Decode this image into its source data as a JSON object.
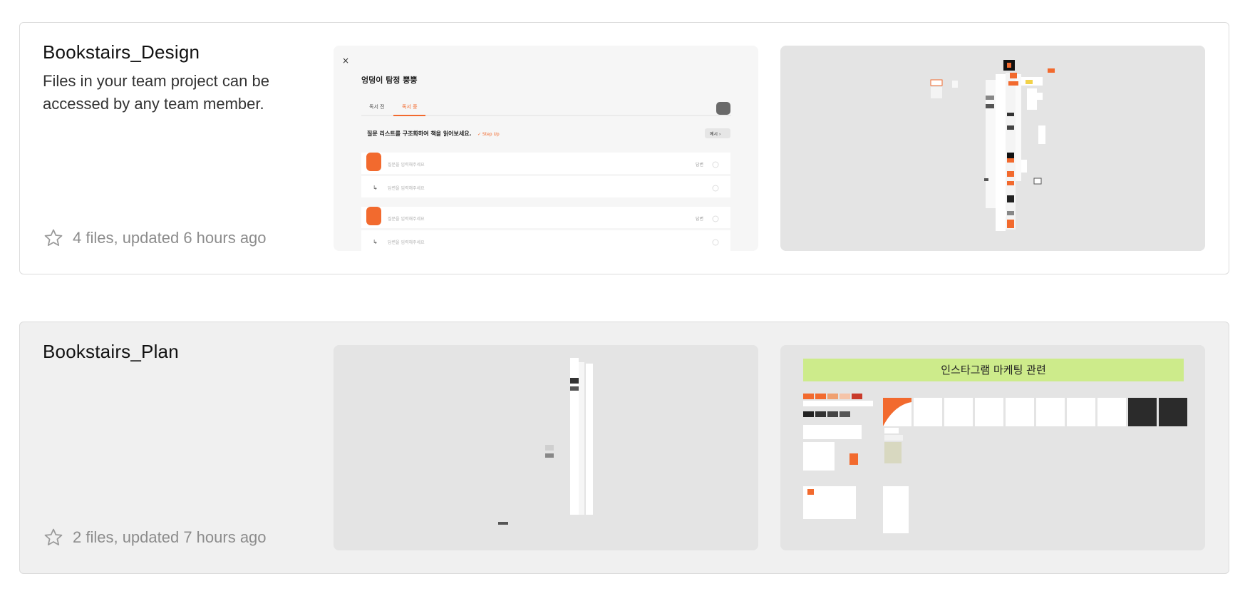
{
  "projects": [
    {
      "name": "Bookstairs_Design",
      "description": "Files in your team project can be accessed by any team member.",
      "meta": "4 files, updated 6 hours ago",
      "thumbnails": [
        {
          "close": "×",
          "title": "엉덩이 탐정 뿡뿡",
          "tabs": [
            "독서 전",
            "독서 중"
          ],
          "heading": "질문 리스트를 구조화하여 책을 읽어보세요.",
          "step": "✓ Step Up",
          "button": "예시 ›",
          "q_placeholder": "질문을 입력해주세요",
          "a_placeholder": "답변을 입력해주세요",
          "row_action": "답변"
        },
        {}
      ]
    },
    {
      "name": "Bookstairs_Plan",
      "description": "",
      "meta": "2 files, updated 7 hours ago",
      "thumbnails": [
        {},
        {
          "banner": "인스타그램 마케팅 관련"
        }
      ]
    }
  ],
  "colors": {
    "accent": "#f26a2e",
    "banner": "#cdeb8b",
    "card_hover": "#f0f0f0",
    "thumb_bg": "#e4e4e4"
  },
  "icons": {
    "star": "star-icon"
  }
}
